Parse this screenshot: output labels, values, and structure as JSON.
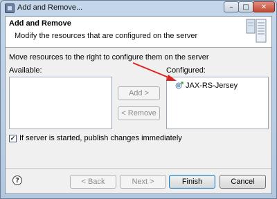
{
  "window": {
    "title": "Add and Remove...",
    "minimize_glyph": "–",
    "maximize_glyph": "□",
    "close_glyph": "✕"
  },
  "header": {
    "heading": "Add and Remove",
    "subheading": "Modify the resources that are configured on the server"
  },
  "body": {
    "instructions": "Move resources to the right to configure them on the server",
    "available_label": "Available:",
    "configured_label": "Configured:",
    "available_items": [],
    "configured_items": [
      {
        "label": "JAX-RS-Jersey",
        "icon": "module-icon"
      }
    ],
    "add_label": "Add >",
    "remove_label": "< Remove",
    "publish_label": "If server is started, publish changes immediately",
    "publish_checked": true
  },
  "footer": {
    "help_label": "?",
    "back_label": "< Back",
    "next_label": "Next >",
    "finish_label": "Finish",
    "cancel_label": "Cancel"
  },
  "colors": {
    "annotation_arrow": "#e0201c",
    "accent_focus": "#3c7fb1"
  }
}
